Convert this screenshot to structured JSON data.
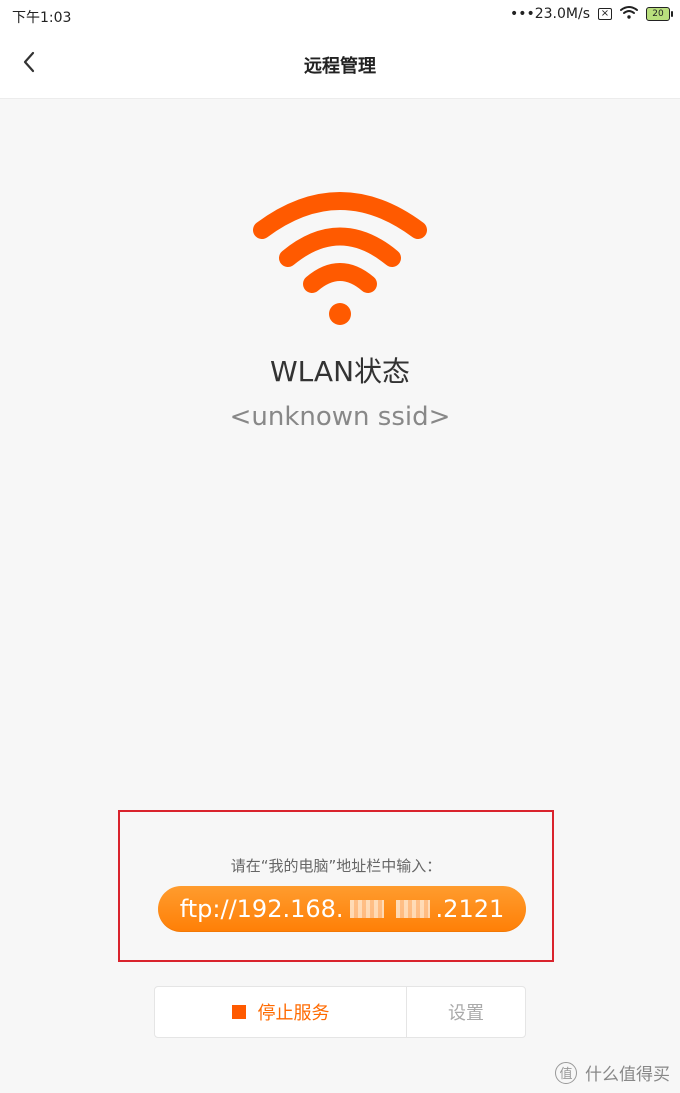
{
  "status_bar": {
    "time": "下午1:03",
    "network_speed": "•••23.0M/s",
    "battery_level": "20",
    "icons": [
      "sim-off-icon",
      "wifi-icon",
      "battery-icon"
    ]
  },
  "header": {
    "title": "远程管理",
    "back_icon": "chevron-left-icon"
  },
  "main": {
    "wifi_icon": "wifi-icon",
    "wifi_color": "#ff5a00",
    "wlan_title": "WLAN状态",
    "ssid": "<unknown ssid>",
    "instruction": "请在“我的电脑”地址栏中输入：",
    "ftp_prefix": "ftp://192.168.",
    "ftp_suffix": ".2121"
  },
  "actions": {
    "stop_service_label": "停止服务",
    "settings_label": "设置",
    "stop_icon": "stop-square-icon"
  },
  "watermark": {
    "badge_text": "值",
    "text": "什么值得买"
  },
  "colors": {
    "accent": "#ff7f06",
    "highlight_border": "#d9232d",
    "page_background": "#f7f7f7"
  }
}
